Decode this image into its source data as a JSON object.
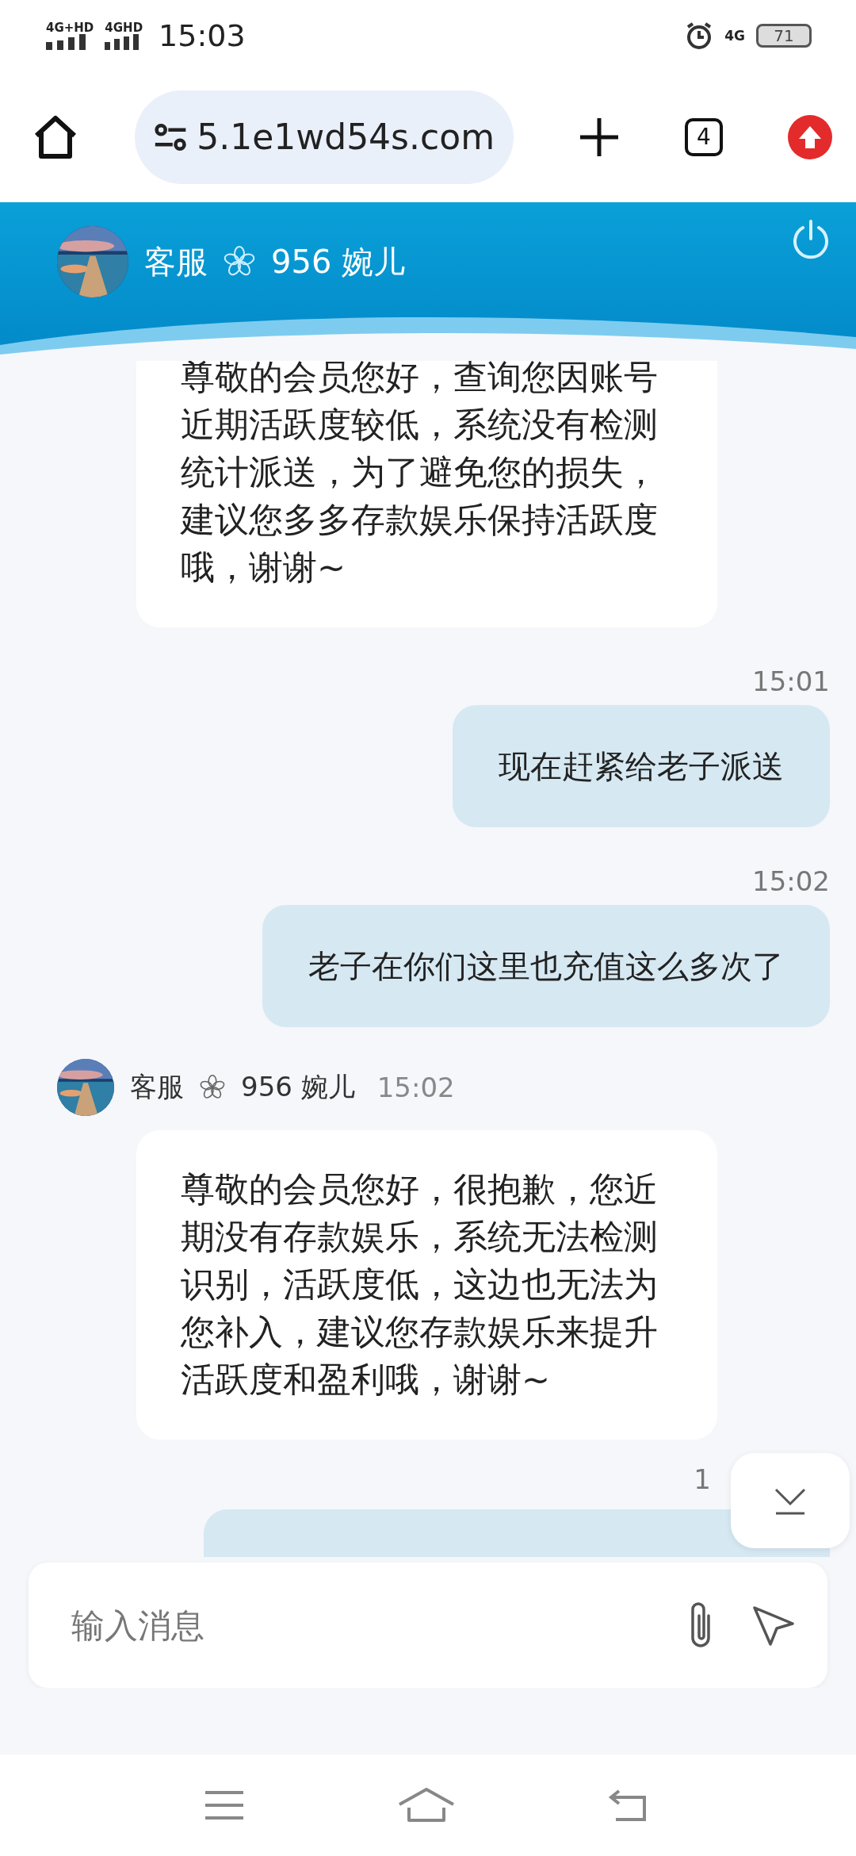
{
  "status_bar": {
    "signal_1": "4G+HD",
    "signal_2": "4GHD",
    "time": "15:03",
    "network": "4G",
    "battery": "71"
  },
  "browser": {
    "url": "5.1e1wd54s.com",
    "tab_count": "4"
  },
  "chat_header": {
    "name_prefix": "客服",
    "name_suffix": "956 婉儿"
  },
  "messages": [
    {
      "kind": "incoming",
      "text": "尊敬的会员您好，查询您因账号近期活跃度较低，系统没有检测统计派送，为了避免您的损失，建议您多多存款娱乐保持活跃度哦，谢谢~"
    },
    {
      "kind": "time",
      "text": "15:01"
    },
    {
      "kind": "outgoing",
      "text": "现在赶紧给老子派送"
    },
    {
      "kind": "time",
      "text": "15:02"
    },
    {
      "kind": "outgoing",
      "text": "老子在你们这里也充值这么多次了"
    },
    {
      "kind": "sender",
      "name_prefix": "客服",
      "name_suffix": "956 婉儿",
      "time": "15:02"
    },
    {
      "kind": "incoming",
      "text": "尊敬的会员您好，很抱歉，您近期没有存款娱乐，系统无法检测识别，活跃度低，这边也无法为您补入，建议您存款娱乐来提升活跃度和盈利哦，谢谢~"
    },
    {
      "kind": "time",
      "text": "1"
    },
    {
      "kind": "outgoing_partial"
    }
  ],
  "composer": {
    "placeholder": "输入消息"
  }
}
